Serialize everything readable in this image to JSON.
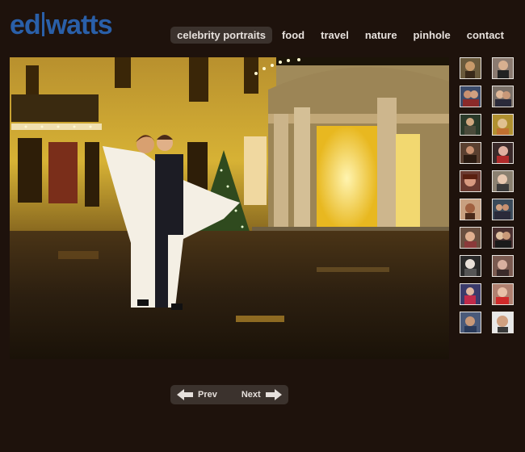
{
  "logo": {
    "part1": "ed",
    "part2": "watts"
  },
  "nav": [
    {
      "label": "celebrity portraits",
      "active": true
    },
    {
      "label": "food"
    },
    {
      "label": "travel"
    },
    {
      "label": "nature"
    },
    {
      "label": "pinhole"
    },
    {
      "label": "contact"
    }
  ],
  "main_photo": {
    "icon": "wedding-couple-photo"
  },
  "thumbnails_count": 20,
  "pager": {
    "prev_label": "Prev",
    "next_label": "Next"
  },
  "colors": {
    "background": "#1e120c",
    "brand_blue": "#2a5fa8",
    "nav_active_bg": "#3b322d",
    "text": "#e6e0dc"
  }
}
